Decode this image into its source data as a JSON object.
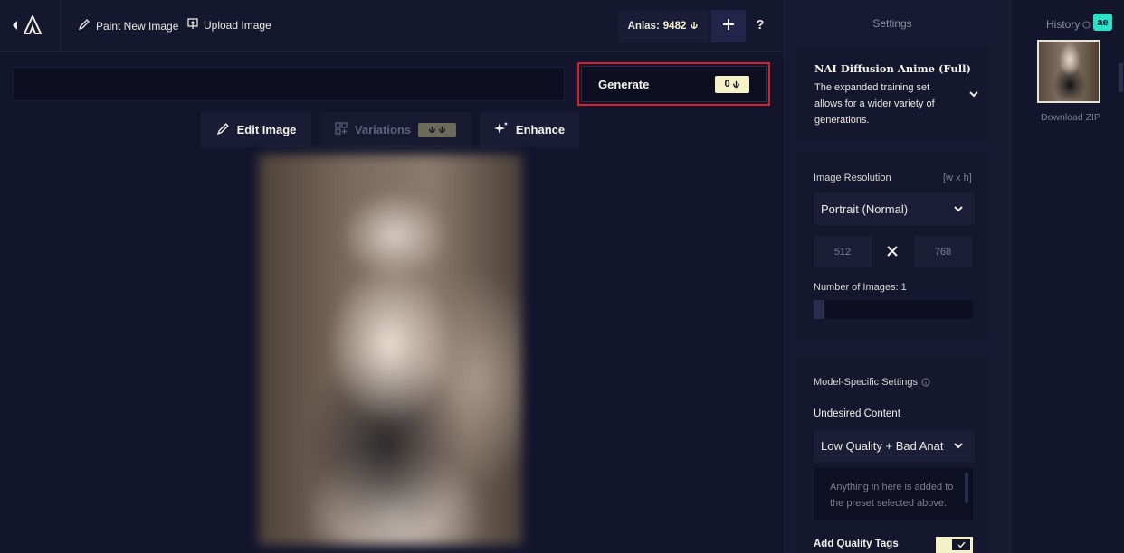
{
  "topbar": {
    "paint_label": "Paint New Image",
    "upload_label": "Upload Image",
    "anlas_label": "Anlas:",
    "anlas_value": "9482",
    "help_label": "?"
  },
  "prompt": {
    "value": ""
  },
  "generate": {
    "label": "Generate",
    "cost": "0"
  },
  "tools": {
    "edit_label": "Edit Image",
    "variations_label": "Variations",
    "enhance_label": "Enhance"
  },
  "settings": {
    "title": "Settings",
    "model": {
      "name": "NAI Diffusion Anime (Full)",
      "description": "The expanded training set allows for a wider variety of generations."
    },
    "resolution": {
      "label": "Image Resolution",
      "hint": "[w x h]",
      "selected": "Portrait (Normal)",
      "width": "512",
      "height": "768"
    },
    "num_images": {
      "label": "Number of Images:",
      "value": "1",
      "fraction": 0
    },
    "model_specific_label": "Model-Specific Settings",
    "undesired": {
      "label": "Undesired Content",
      "selected": "Low Quality + Bad Anatomy",
      "placeholder": "Anything in here is added to the preset selected above."
    },
    "quality_tags_label": "Add Quality Tags",
    "quality_tags_on": true
  },
  "history": {
    "title": "History",
    "badge": "ae",
    "download_label": "Download ZIP"
  },
  "colors": {
    "background": "#13152d",
    "accent_yellow": "#f5f1c6",
    "highlight_red": "#d8212a",
    "badge_teal": "#2ee0c7"
  }
}
